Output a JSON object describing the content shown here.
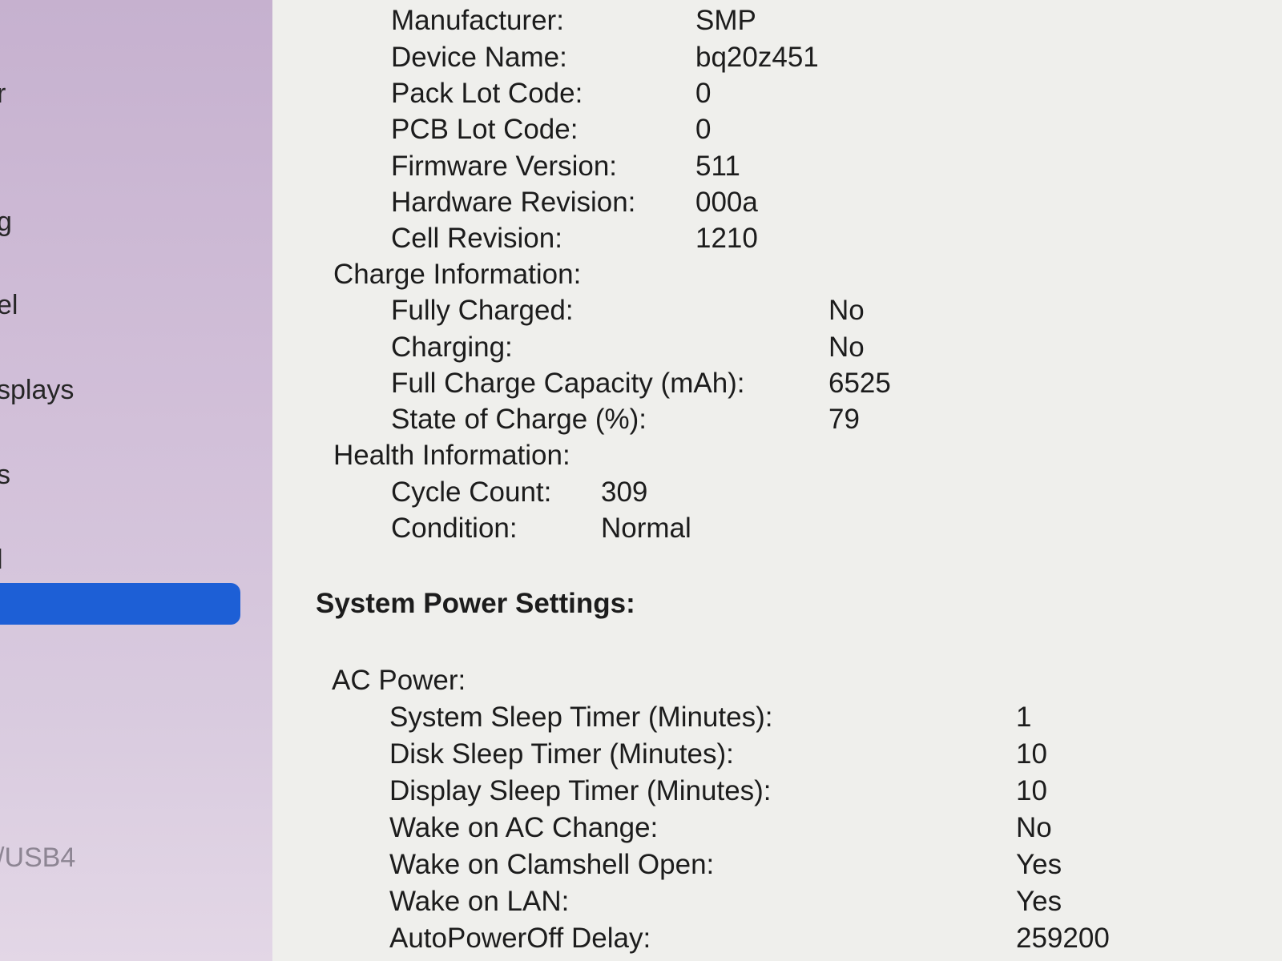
{
  "sidebar": {
    "items": [
      {
        "label": "r"
      },
      {
        "label": "g"
      },
      {
        "label": "el"
      },
      {
        "label": "splays"
      },
      {
        "label": "s"
      },
      {
        "label": "l"
      },
      {
        "label": ""
      },
      {
        "label": "/USB4"
      }
    ],
    "selected_color": "#1d5fd6"
  },
  "battery": {
    "manufacturer_label": "Manufacturer:",
    "manufacturer": "SMP",
    "device_name_label": "Device Name:",
    "device_name": "bq20z451",
    "pack_lot_label": "Pack Lot Code:",
    "pack_lot": "0",
    "pcb_lot_label": "PCB Lot Code:",
    "pcb_lot": "0",
    "firmware_label": "Firmware Version:",
    "firmware": "511",
    "hardware_label": "Hardware Revision:",
    "hardware": "000a",
    "cell_label": "Cell Revision:",
    "cell": "1210"
  },
  "charge": {
    "heading": "Charge Information:",
    "fully_charged_label": "Fully Charged:",
    "fully_charged": "No",
    "charging_label": "Charging:",
    "charging": "No",
    "capacity_label": "Full Charge Capacity (mAh):",
    "capacity": "6525",
    "soc_label": "State of Charge (%):",
    "soc": "79"
  },
  "health": {
    "heading": "Health Information:",
    "cycle_label": "Cycle Count:",
    "cycle": "309",
    "condition_label": "Condition:",
    "condition": "Normal"
  },
  "power": {
    "title": "System Power Settings:",
    "ac_heading": "AC Power:",
    "rows": [
      {
        "label": "System Sleep Timer (Minutes):",
        "value": "1"
      },
      {
        "label": "Disk Sleep Timer (Minutes):",
        "value": "10"
      },
      {
        "label": "Display Sleep Timer (Minutes):",
        "value": "10"
      },
      {
        "label": "Wake on AC Change:",
        "value": "No"
      },
      {
        "label": "Wake on Clamshell Open:",
        "value": "Yes"
      },
      {
        "label": "Wake on LAN:",
        "value": "Yes"
      },
      {
        "label": "AutoPowerOff Delay:",
        "value": "259200"
      }
    ]
  }
}
